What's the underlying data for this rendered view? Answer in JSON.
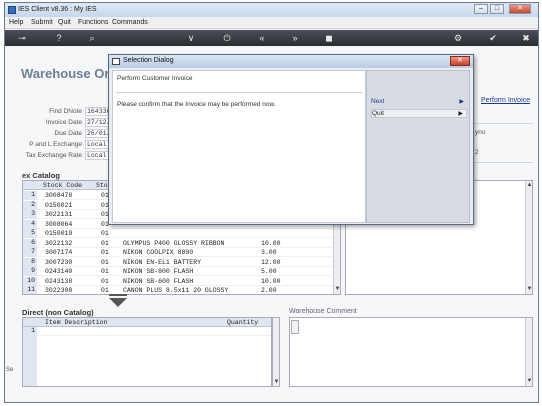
{
  "window": {
    "title": "IES Client v8.36 : My IES"
  },
  "menu": [
    "Help",
    "Submit",
    "Quit",
    "Functions",
    "Commands"
  ],
  "window_controls": {
    "minimize": "–",
    "maximize": "□",
    "close": "✕"
  },
  "toolbar_icons": {
    "key": "⊸",
    "help": "?",
    "search": "⌕",
    "down": "∨",
    "power": "⏻",
    "first": "«",
    "last": "»",
    "stop": "◼",
    "settings": "⚙",
    "ok": "✔",
    "cancel": "✖"
  },
  "page": {
    "heading": "Warehouse Or",
    "perform_invoice": "Perform Invoice",
    "fields": [
      {
        "label": "Find DNote",
        "value": "164336"
      },
      {
        "label": "Invoice Date",
        "value": "27/12/"
      },
      {
        "label": "Due Date",
        "value": "26/01/"
      },
      {
        "label": "P and L Exchange",
        "value": "Local"
      },
      {
        "label": "Tax Exchange Rate",
        "value": "Local"
      }
    ],
    "right_partial": [
      "yno",
      "2"
    ]
  },
  "catalog": {
    "title": "ex Catalog",
    "headers": {
      "code": "Stock Code",
      "sto": "Sto"
    },
    "rows": [
      {
        "n": "1",
        "code": "3008478",
        "sto": "01",
        "desc": "",
        "qty": ""
      },
      {
        "n": "2",
        "code": "0150021",
        "sto": "01",
        "desc": "",
        "qty": ""
      },
      {
        "n": "3",
        "code": "3022131",
        "sto": "01",
        "desc": "",
        "qty": ""
      },
      {
        "n": "4",
        "code": "3008064",
        "sto": "01",
        "desc": "",
        "qty": ""
      },
      {
        "n": "5",
        "code": "0150019",
        "sto": "01",
        "desc": "",
        "qty": ""
      },
      {
        "n": "6",
        "code": "3022132",
        "sto": "01",
        "desc": "OLYMPUS P400 GLOSSY RIBBON",
        "qty": "10.00"
      },
      {
        "n": "7",
        "code": "3007174",
        "sto": "01",
        "desc": "NIKON COOLPIX 8800",
        "qty": "3.00"
      },
      {
        "n": "8",
        "code": "3007230",
        "sto": "01",
        "desc": "NIKON EN-EL1 BATTERY",
        "qty": "12.00"
      },
      {
        "n": "9",
        "code": "0243140",
        "sto": "01",
        "desc": "NIKON SB-800 FLASH",
        "qty": "5.00"
      },
      {
        "n": "10",
        "code": "0243138",
        "sto": "01",
        "desc": "NIKON SB-600 FLASH",
        "qty": "10.00"
      },
      {
        "n": "11",
        "code": "3022308",
        "sto": "01",
        "desc": "CANON PLUS 8.5x11 20 GLOSSY",
        "qty": "2.00"
      }
    ]
  },
  "direct": {
    "title": "Direct (non Catalog)",
    "headers": {
      "desc": "Item Description",
      "qty": "Quantity"
    },
    "rows": [
      {
        "n": "1"
      }
    ]
  },
  "warehouse_comment": {
    "label": "Warehouse Comment"
  },
  "side_partial": "Se",
  "dialog": {
    "title": "Selection Dialog",
    "heading": "Perform Customer Invoice",
    "message": "Please confirm that the Invoice may be performed now.",
    "options": [
      {
        "label": "Next",
        "arrow": "▶"
      },
      {
        "label": "Quit",
        "arrow": "▶"
      }
    ],
    "close": "✕"
  },
  "colors": {
    "toolbar": "#2f3338",
    "heading": "#6e7f94",
    "link": "#1a3a8a"
  }
}
